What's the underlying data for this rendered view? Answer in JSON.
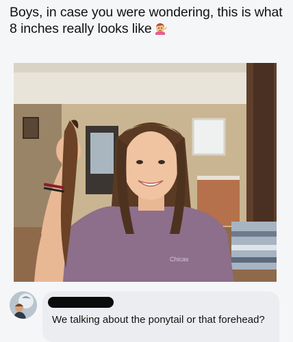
{
  "post": {
    "text": "Boys, in case you were wondering, this is what 8 inches really looks like",
    "emoji_icon": "woman-tipping-hand-emoji"
  },
  "photo": {
    "subject": "smiling-girl-holding-cut-ponytail"
  },
  "comment": {
    "author_redacted": true,
    "text": "We talking about the ponytail or that forehead?"
  },
  "colors": {
    "background": "#f5f6f8",
    "bubble": "#ebedf0",
    "shirt": "#8d6e8b",
    "redaction": "#0b0b0b"
  }
}
